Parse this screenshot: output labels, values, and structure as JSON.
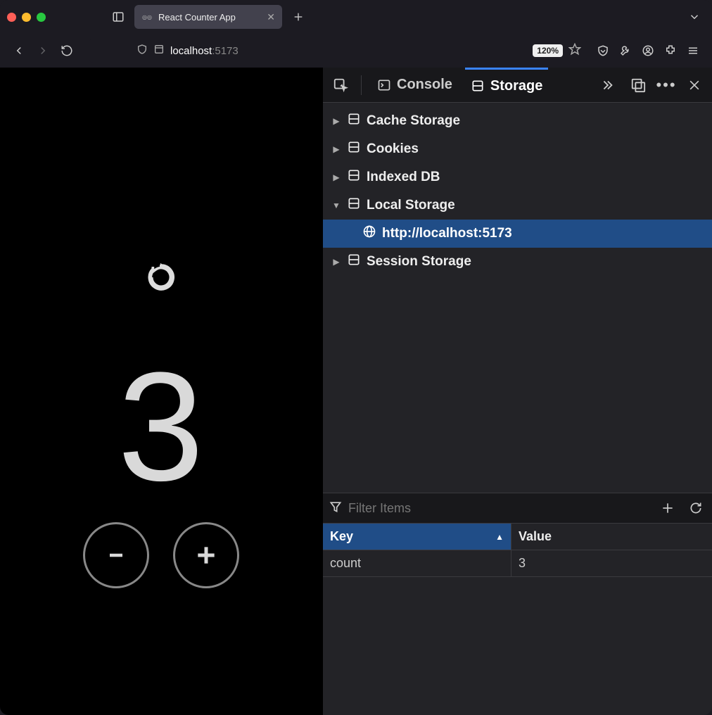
{
  "tab": {
    "title": "React Counter App"
  },
  "url": {
    "host": "localhost",
    "port": ":5173",
    "zoom": "120%"
  },
  "app": {
    "counter_value": "3"
  },
  "devtools": {
    "tabs": {
      "console": "Console",
      "storage": "Storage"
    },
    "tree": {
      "cache": "Cache Storage",
      "cookies": "Cookies",
      "indexed": "Indexed DB",
      "local": "Local Storage",
      "local_origin": "http://localhost:5173",
      "session": "Session Storage"
    },
    "filter_placeholder": "Filter Items",
    "table": {
      "key_header": "Key",
      "value_header": "Value",
      "rows": [
        {
          "key": "count",
          "value": "3"
        }
      ]
    }
  }
}
